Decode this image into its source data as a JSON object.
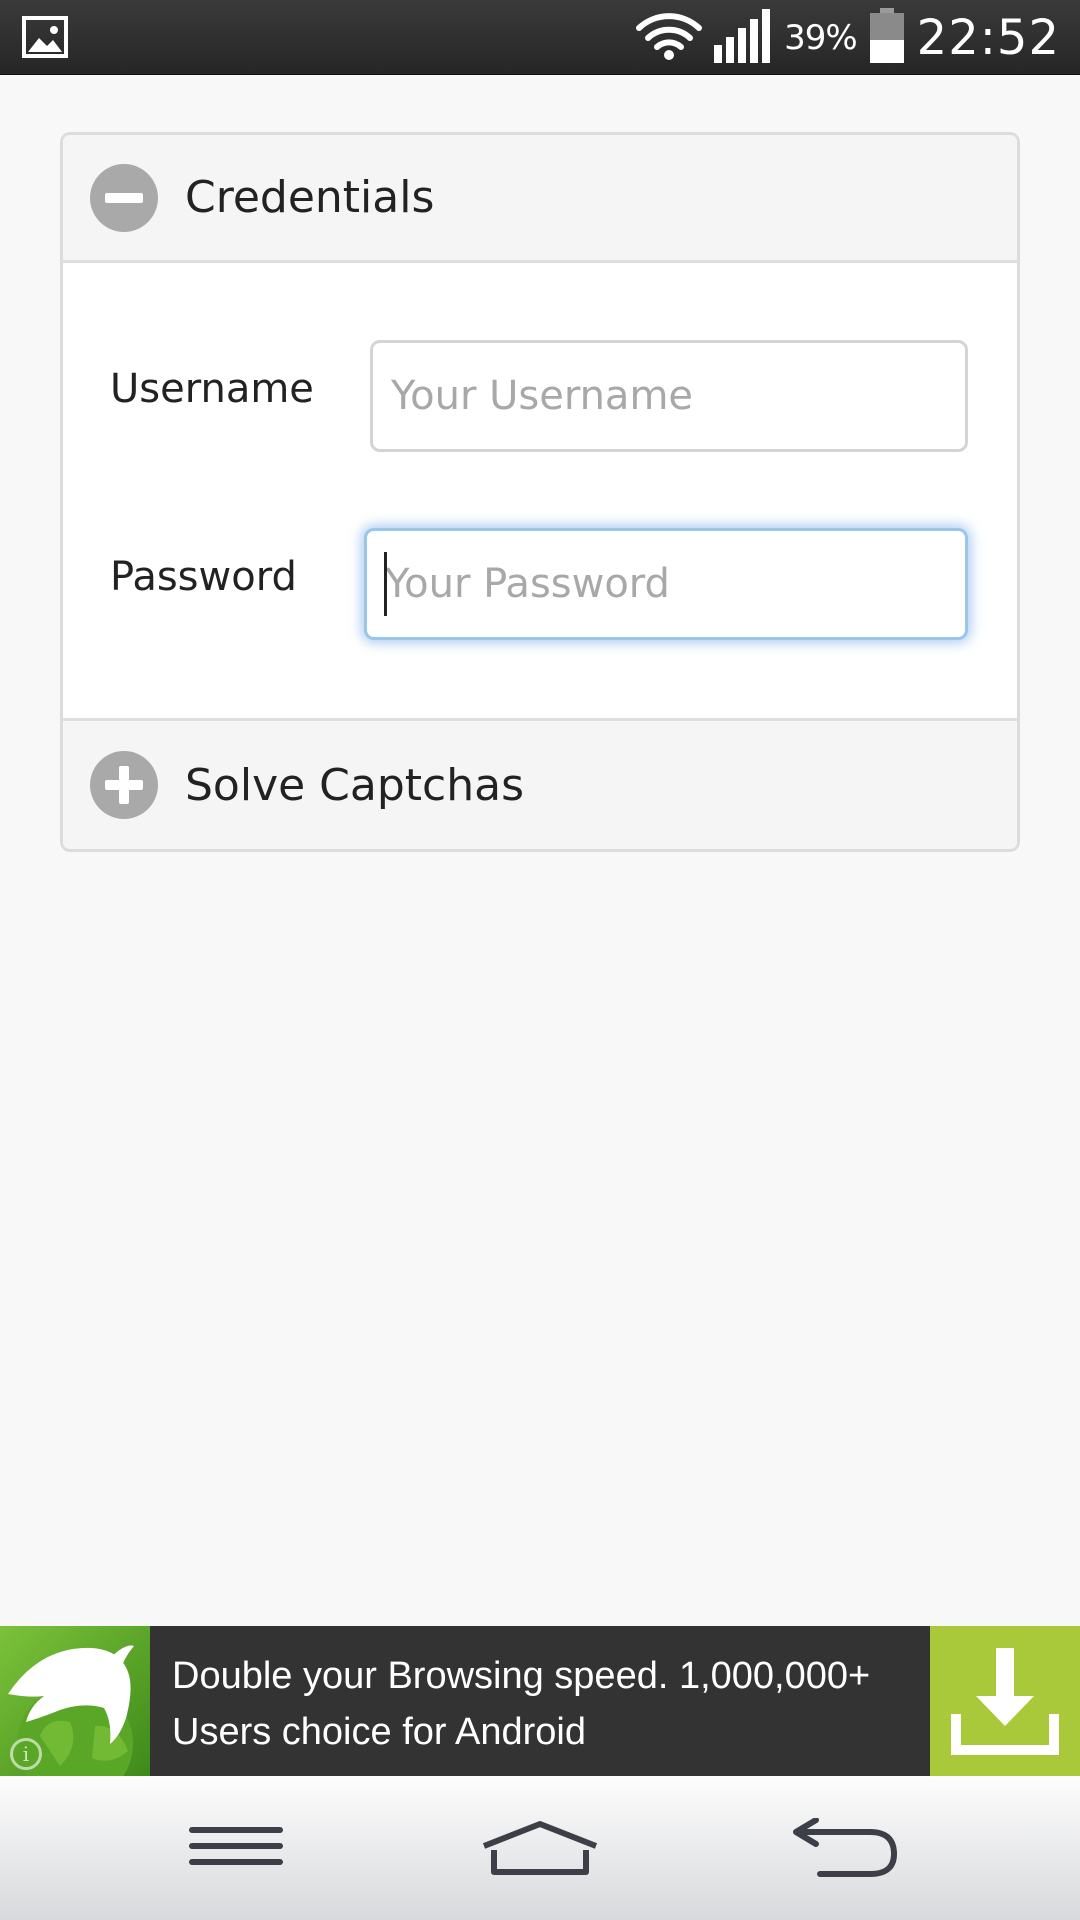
{
  "status_bar": {
    "battery_percent": "39%",
    "time": "22:52",
    "icons": [
      "gallery-notification-icon",
      "wifi-icon",
      "signal-icon",
      "battery-icon"
    ]
  },
  "accordion": {
    "credentials": {
      "title": "Credentials",
      "icon": "collapse-minus-icon",
      "expanded": true
    },
    "captchas": {
      "title": "Solve Captchas",
      "icon": "expand-plus-icon",
      "expanded": false
    }
  },
  "form": {
    "username": {
      "label": "Username",
      "placeholder": "Your Username",
      "value": ""
    },
    "password": {
      "label": "Password",
      "placeholder": "Your Password",
      "value": "",
      "focused": true
    }
  },
  "ad": {
    "text": "Double your Browsing speed. 1,000,000+ Users choice for Android",
    "logo_icon": "dolphin-browser-icon",
    "action_icon": "download-icon",
    "info_icon": "info-icon"
  },
  "nav_bar": {
    "buttons": [
      "menu-icon",
      "home-icon",
      "back-icon"
    ]
  },
  "colors": {
    "accent_focus": "#9cc5ea",
    "ad_green": "#a9c83a",
    "icon_gray": "#a9a9a9"
  }
}
